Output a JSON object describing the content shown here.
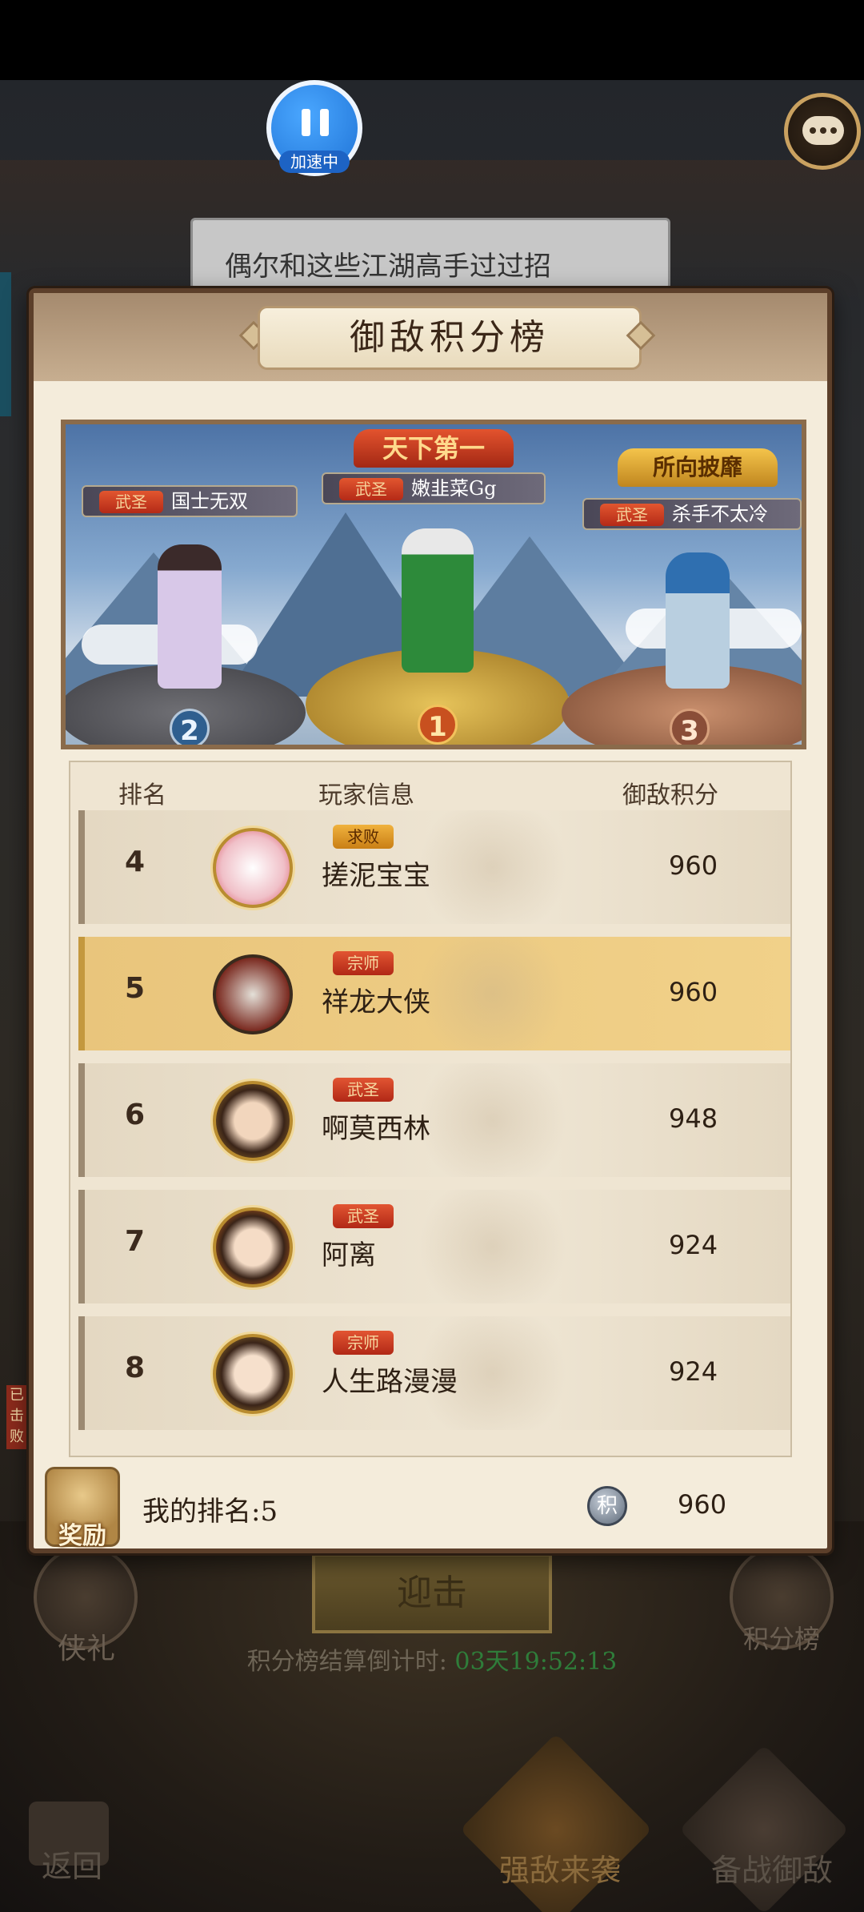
{
  "status": {
    "accelerating_label": "加速中"
  },
  "dialog": {
    "text": "偶尔和这些江湖高手过过招"
  },
  "panel": {
    "title": "御敌积分榜",
    "podium": {
      "first": {
        "crown": "天下第一",
        "badge": "武圣",
        "name": "嫩韭菜Gg",
        "rank": "1"
      },
      "second": {
        "badge": "武圣",
        "name": "国士无双",
        "rank": "2"
      },
      "third": {
        "crown": "所向披靡",
        "badge": "武圣",
        "name": "杀手不太冷",
        "rank": "3"
      }
    },
    "table": {
      "headers": {
        "rank": "排名",
        "player": "玩家信息",
        "score": "御敌积分"
      },
      "rows": [
        {
          "rank": "4",
          "badge": "求败",
          "name": "搓泥宝宝",
          "score": "960"
        },
        {
          "rank": "5",
          "badge": "宗师",
          "name": "祥龙大侠",
          "score": "960"
        },
        {
          "rank": "6",
          "badge": "武圣",
          "name": "啊莫西林",
          "score": "948"
        },
        {
          "rank": "7",
          "badge": "武圣",
          "name": "阿离",
          "score": "924"
        },
        {
          "rank": "8",
          "badge": "宗师",
          "name": "人生路漫漫",
          "score": "924"
        }
      ]
    },
    "footer": {
      "reward_label": "奖励",
      "my_rank": "我的排名:5",
      "score_icon_char": "积",
      "my_score": "960"
    }
  },
  "underlay": {
    "engage_button": "迎击",
    "left_button": "侠礼",
    "right_button": "积分榜",
    "countdown_label": "积分榜结算倒计时:",
    "countdown_time": "03天19:52:13",
    "side_tag": "已击败"
  },
  "nav": {
    "back": "返回",
    "tab_strong_enemy": "强敌来袭",
    "tab_prepare": "备战御敌"
  },
  "colors": {
    "panel_bg": "#f4ecdb",
    "highlight_row": "#f1d189",
    "badge_red": "#b12816",
    "countdown_green": "#2f7d3a"
  }
}
